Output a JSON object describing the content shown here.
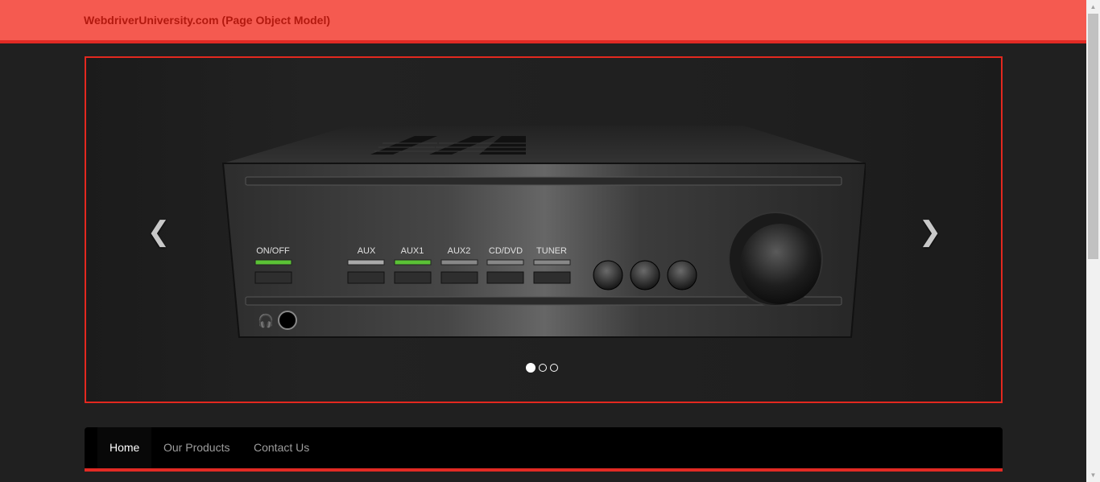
{
  "header": {
    "brand": "WebdriverUniversity.com (Page Object Model)"
  },
  "carousel": {
    "prev_icon": "chevron-left-icon",
    "next_icon": "chevron-right-icon",
    "slide_count": 3,
    "active_slide": 1,
    "amplifier": {
      "labels": [
        "ON/OFF",
        "AUX",
        "AUX1",
        "AUX2",
        "CD/DVD",
        "TUNER"
      ],
      "lit": [
        "ON/OFF",
        "AUX1"
      ],
      "light_on_color": "#5bc236"
    }
  },
  "nav": {
    "items": [
      {
        "label": "Home",
        "active": true
      },
      {
        "label": "Our Products",
        "active": false
      },
      {
        "label": "Contact Us",
        "active": false
      }
    ]
  },
  "colors": {
    "accent": "#e22a24",
    "header_bg": "#f55a50",
    "brand_text": "#b3190f"
  }
}
